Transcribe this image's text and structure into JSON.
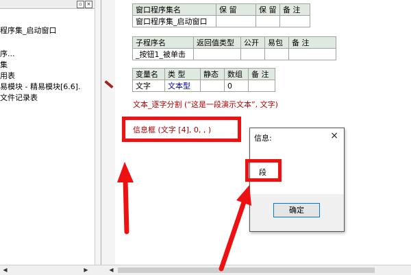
{
  "left_pane": {
    "title_buttons": [
      "▫",
      "×"
    ],
    "tree_items": [
      "程序集_启动窗口",
      "序...",
      "集",
      "用表",
      "易模块 - 精易模块[6.6].",
      "文件记录表"
    ]
  },
  "assembly_table": {
    "headers": [
      "窗口程序集名",
      "保 留",
      "保 留",
      "备 注"
    ],
    "row": [
      "窗口程序集_启动窗口",
      "",
      "",
      ""
    ]
  },
  "sub_table": {
    "headers": [
      "子程序名",
      "返回值类型",
      "公开",
      "易包",
      "备 注"
    ],
    "row": [
      "_按钮1_被单击",
      "",
      "",
      "",
      ""
    ]
  },
  "var_table": {
    "headers": [
      "变量名",
      "类 型",
      "静态",
      "数组",
      "备 注"
    ],
    "row": [
      "文字",
      "文本型",
      "",
      "0",
      ""
    ]
  },
  "code_lines": {
    "line1": "文本_逐字分割 (“这是一段演示文本”, 文字)",
    "line2": "信息框 (文字 [4], 0, , )"
  },
  "dialog": {
    "title": "信息:",
    "close": "×",
    "message": "段",
    "ok_label": "确定"
  },
  "colors": {
    "highlight": "#ee1111",
    "code_red": "#b00000",
    "type_blue": "#0000c0",
    "table_header_bg": "#dfe9df"
  }
}
